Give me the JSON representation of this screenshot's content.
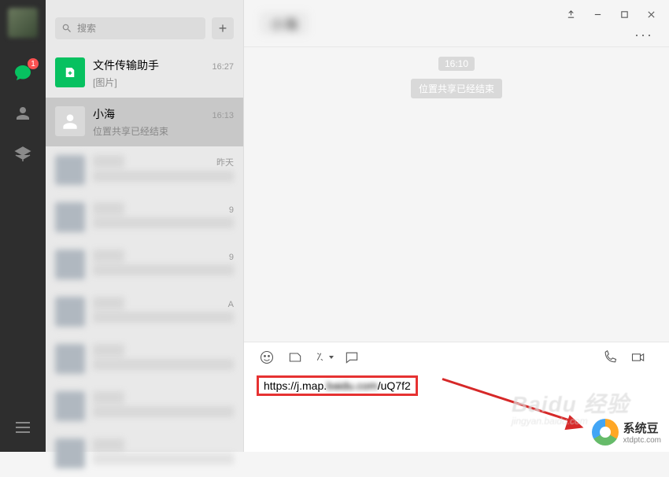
{
  "nav": {
    "chat_badge": "1"
  },
  "search": {
    "placeholder": "搜索"
  },
  "add_label": "+",
  "conversations": [
    {
      "name": "文件传输助手",
      "sub": "[图片]",
      "time": "16:27"
    },
    {
      "name": "小海",
      "sub": "位置共享已经结束",
      "time": "16:13"
    },
    {
      "name": "████",
      "sub": "████████████",
      "time": "昨天"
    },
    {
      "name": "████",
      "sub": "████████",
      "time": "9"
    },
    {
      "name": "████",
      "sub": "████████",
      "time": "9"
    },
    {
      "name": "████",
      "sub": "████████",
      "time": "A"
    },
    {
      "name": "████",
      "sub": "████████",
      "time": ""
    },
    {
      "name": "████",
      "sub": "████████",
      "time": ""
    },
    {
      "name": "████",
      "sub": "████████",
      "time": ""
    }
  ],
  "chat": {
    "title": "小海",
    "more": "···",
    "time_pill": "16:10",
    "sys_pill": "位置共享已经结束",
    "input_url_pre": "https://j.map.",
    "input_url_mid": "baidu.com",
    "input_url_suf": "/uQ7f2"
  },
  "watermark": {
    "baidu": "Baidu 经验",
    "baidu_sub": "jingyan.baidu.com",
    "brand": "系统豆",
    "brand_url": "xtdptc.com"
  }
}
